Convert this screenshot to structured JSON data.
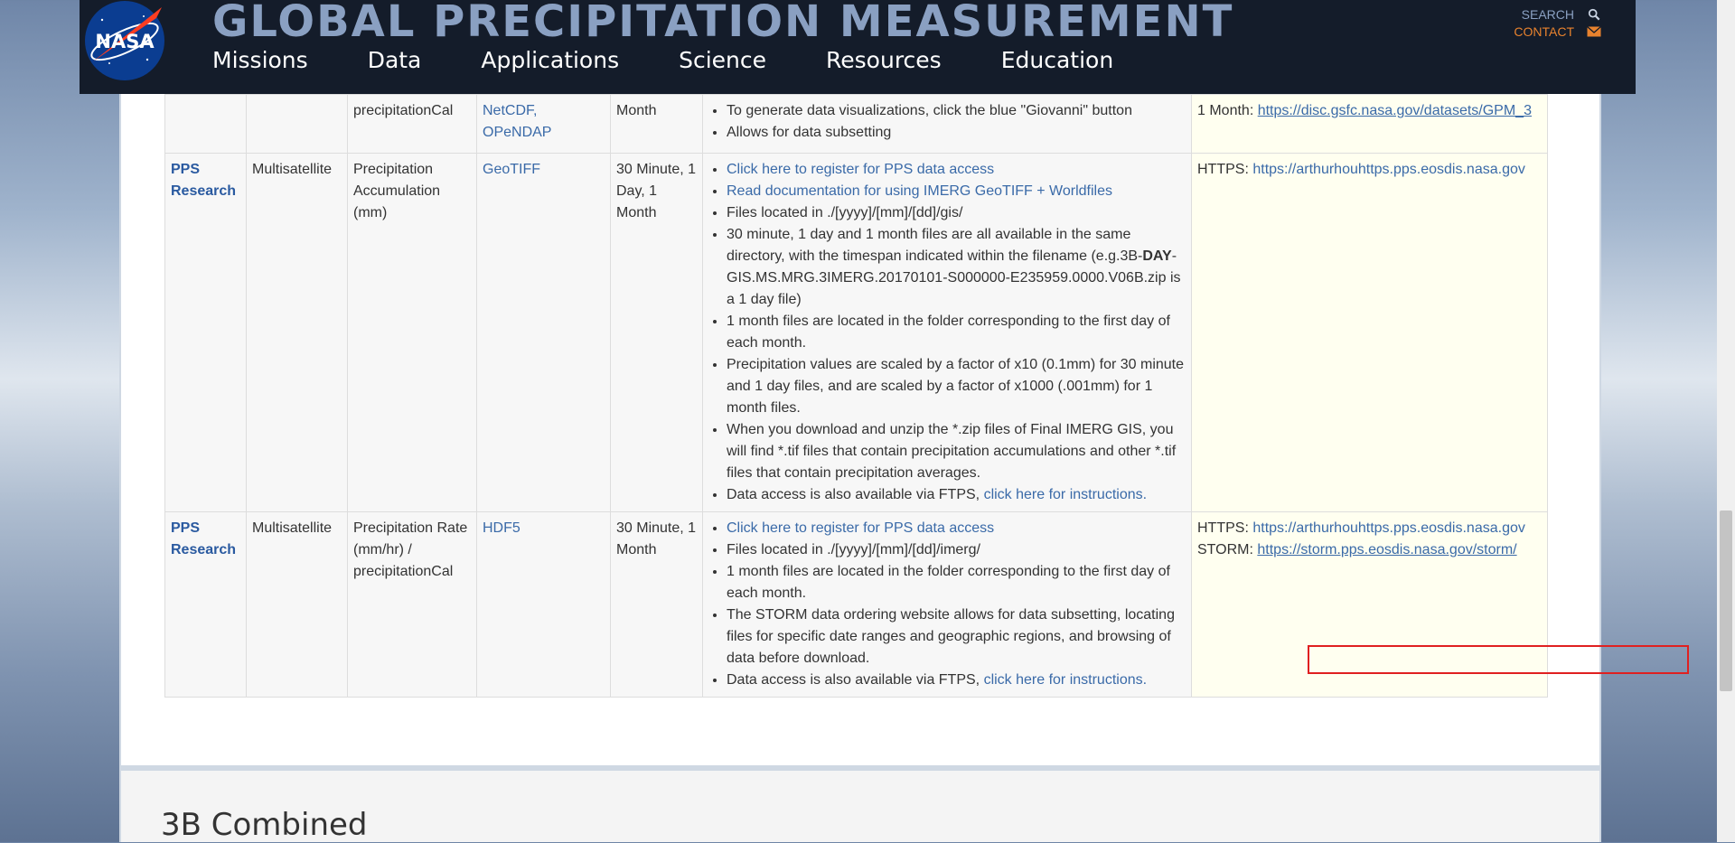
{
  "header": {
    "site_title": "GLOBAL PRECIPITATION MEASUREMENT",
    "logo_text": "NASA",
    "nav": [
      "Missions",
      "Data",
      "Applications",
      "Science",
      "Resources",
      "Education"
    ],
    "search_label": "SEARCH",
    "contact_label": "CONTACT"
  },
  "table": {
    "row_prev": {
      "product": "precipitationCal",
      "format": "NetCDF, OPeNDAP",
      "latency": "Month",
      "notes": [
        "To generate data visualizations, click the blue \"Giovanni\" button",
        "Allows for data subsetting"
      ],
      "access_prefix": "1 Month: ",
      "access_link": "https://disc.gsfc.nasa.gov/datasets/GPM_3"
    },
    "row_gis": {
      "provider": "PPS Research",
      "source": "Multisatellite",
      "product": "Precipitation Accumulation (mm)",
      "format": "GeoTIFF",
      "latency": "30 Minute, 1 Day, 1 Month",
      "note_link_1": "Click here to register for PPS data access",
      "note_link_2": "Read documentation for using IMERG GeoTIFF + Worldfiles",
      "note_3": "Files located in ./[yyyy]/[mm]/[dd]/gis/",
      "note_4_a": "30 minute,  1 day and 1 month files are all available in the same directory, with the timespan indicated within the filename (e.g.3B-",
      "note_4_bold": "DAY",
      "note_4_b": "-GIS.MS.MRG.3IMERG.20170101-S000000-E235959.0000.V06B.zip is a 1 day file)",
      "note_5": "1 month files are located in the folder corresponding to the first day of each month.",
      "note_6": "Precipitation values are scaled by a factor of x10 (0.1mm) for 30 minute and 1 day files, and are scaled by a factor of x1000 (.001mm) for 1 month files.",
      "note_7": "When you download and unzip the *.zip files of Final IMERG GIS, you will find *.tif files that contain precipitation accumulations and other *.tif files that contain precipitation averages.",
      "note_8_text": "Data access is also available via FTPS, ",
      "note_8_link": "click here for instructions.",
      "access_prefix": "HTTPS: ",
      "access_text": "https://arthurhouhttps.pps.eosdis.nasa.gov"
    },
    "row_hdf": {
      "provider": "PPS Research",
      "source": "Multisatellite",
      "product": "Precipitation Rate (mm/hr) / precipitationCal",
      "format": "HDF5",
      "latency": "30 Minute, 1 Month",
      "note_link_1": "Click here to register for PPS data access",
      "note_2": "Files located in ./[yyyy]/[mm]/[dd]/imerg/",
      "note_3": "1 month files are located in the folder corresponding to the first day of each month.",
      "note_4": "The STORM data ordering website allows for data subsetting, locating files for specific date ranges and geographic regions, and browsing of data before download.",
      "note_5_text": "Data access is also available via FTPS, ",
      "note_5_link": "click here for instructions.",
      "access_prefix": "HTTPS: ",
      "access_text": "https://arthurhouhttps.pps.eosdis.nasa.gov",
      "storm_prefix": "STORM: ",
      "storm_link": "https://storm.pps.eosdis.nasa.gov/storm/"
    }
  },
  "next_section": {
    "title": "3B Combined"
  },
  "colors": {
    "header_bg": "#141c2a",
    "title": "#8aa0c2",
    "contact": "#e8822e",
    "link": "#3a6aa8",
    "highlight": "#e02020",
    "access_bg": "#fffff0"
  }
}
